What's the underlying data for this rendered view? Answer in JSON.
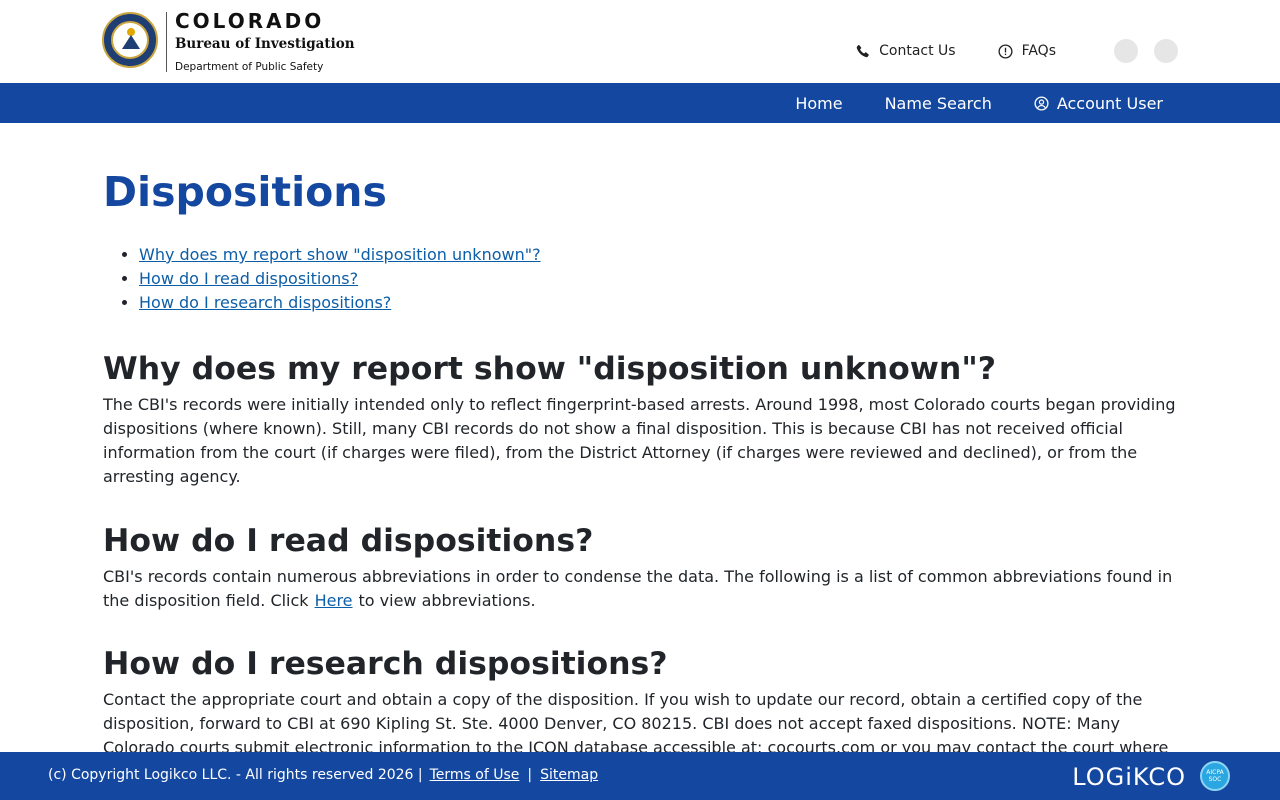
{
  "header": {
    "logo": {
      "colorado": "COLORADO",
      "bureau": "Bureau of Investigation",
      "department": "Department of Public Safety"
    },
    "links": {
      "contact": "Contact Us",
      "faqs": "FAQs"
    },
    "icons": [
      "phone-icon",
      "alert-circle-icon"
    ]
  },
  "nav": {
    "home": "Home",
    "name_search": "Name Search",
    "account_user": "Account User"
  },
  "main": {
    "title": "Dispositions",
    "toc": [
      "Why does my report show \"disposition unknown\"?",
      "How do I read dispositions?",
      "How do I research dispositions?"
    ],
    "sections": [
      {
        "title": "Why does my report show \"disposition unknown\"?",
        "text": "The CBI's records were initially intended only to reflect fingerprint-based arrests. Around 1998, most Colorado courts began providing dispositions (where known). Still, many CBI records do not show a final disposition. This is because CBI has not received official information from the court (if charges were filed), from the District Attorney (if charges were reviewed and declined), or from the arresting agency."
      },
      {
        "title": "How do I read dispositions?",
        "text_before": "CBI's records contain numerous abbreviations in order to condense the data. The following is a list of common abbreviations found in the disposition field. Click",
        "link": "Here",
        "text_after": "to view abbreviations."
      },
      {
        "title": "How do I research dispositions?",
        "text": "Contact the appropriate court and obtain a copy of the disposition. If you wish to update our record, obtain a certified copy of the disposition, forward to CBI at 690 Kipling St. Ste. 4000 Denver, CO 80215. CBI does not accept faxed dispositions. NOTE: Many Colorado courts submit electronic information to the ICON database accessible at: cocourts.com or you may contact the court where"
      }
    ]
  },
  "footer": {
    "copyright": "(c) Copyright Logikco LLC. - All rights reserved 2026 |",
    "terms": "Terms of Use",
    "separator": "|",
    "sitemap": "Sitemap",
    "brand": "LOGiKCO",
    "badge": "AICPA SOC"
  },
  "colors": {
    "brand_blue": "#1448a0",
    "link_blue": "#0d5ea8",
    "text": "#212529"
  }
}
